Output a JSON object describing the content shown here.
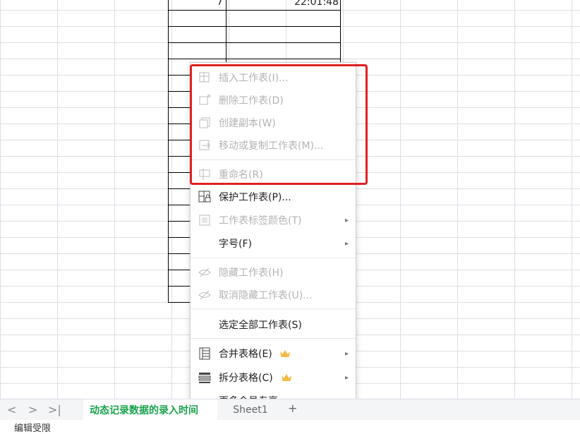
{
  "cells": {
    "a_value": "7",
    "b_value": "22:01:48"
  },
  "menu": {
    "insert": "插入工作表(I)...",
    "delete": "删除工作表(D)",
    "copy": "创建副本(W)",
    "move": "移动或复制工作表(M)...",
    "rename": "重命名(R)",
    "protect": "保护工作表(P)...",
    "tab_color": "工作表标签颜色(T)",
    "font_size": "字号(F)",
    "hide": "隐藏工作表(H)",
    "unhide": "取消隐藏工作表(U)...",
    "select_all": "选定全部工作表(S)",
    "merge": "合并表格(E)",
    "split": "拆分表格(C)",
    "more": "更多会员专享"
  },
  "sheets": {
    "active": "动态记录数据的录入时间",
    "second": "Sheet1",
    "add": "+"
  },
  "nav": {
    "prev": "<",
    "next": ">",
    "last": ">|"
  },
  "status": {
    "text": "编辑受限"
  },
  "colors": {
    "highlight": "#e02020",
    "active_tab_text": "#17a34a",
    "crown": "#f5b942"
  }
}
